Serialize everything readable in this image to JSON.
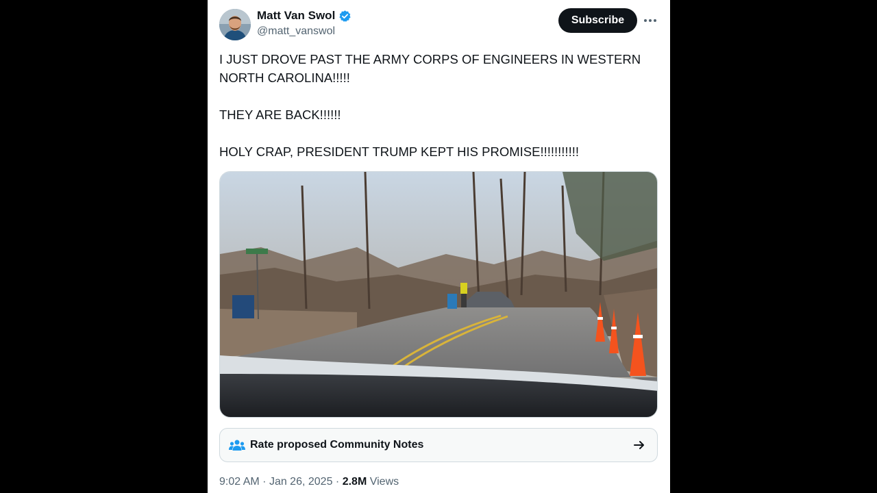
{
  "author": {
    "name": "Matt Van Swol",
    "handle": "@matt_vanswol",
    "verified": true
  },
  "actions": {
    "subscribe_label": "Subscribe",
    "more_icon": "more-horizontal-icon"
  },
  "tweet": {
    "lines": [
      "I JUST DROVE PAST THE ARMY CORPS OF ENGINEERS IN WESTERN NORTH CAROLINA!!!!!",
      "THEY ARE BACK!!!!!!",
      "HOLY CRAP, PRESIDENT TRUMP KEPT HIS PROMISE!!!!!!!!!!!"
    ]
  },
  "community_notes": {
    "label": "Rate proposed Community Notes",
    "icon": "people-icon",
    "arrow_icon": "arrow-right-icon"
  },
  "meta": {
    "time": "9:02 AM",
    "date": "Jan 26, 2025",
    "views_count": "2.8M",
    "views_label": "Views"
  },
  "colors": {
    "accent": "#1d9bf0",
    "text": "#0f1419",
    "muted": "#536471",
    "background": "#000000"
  }
}
